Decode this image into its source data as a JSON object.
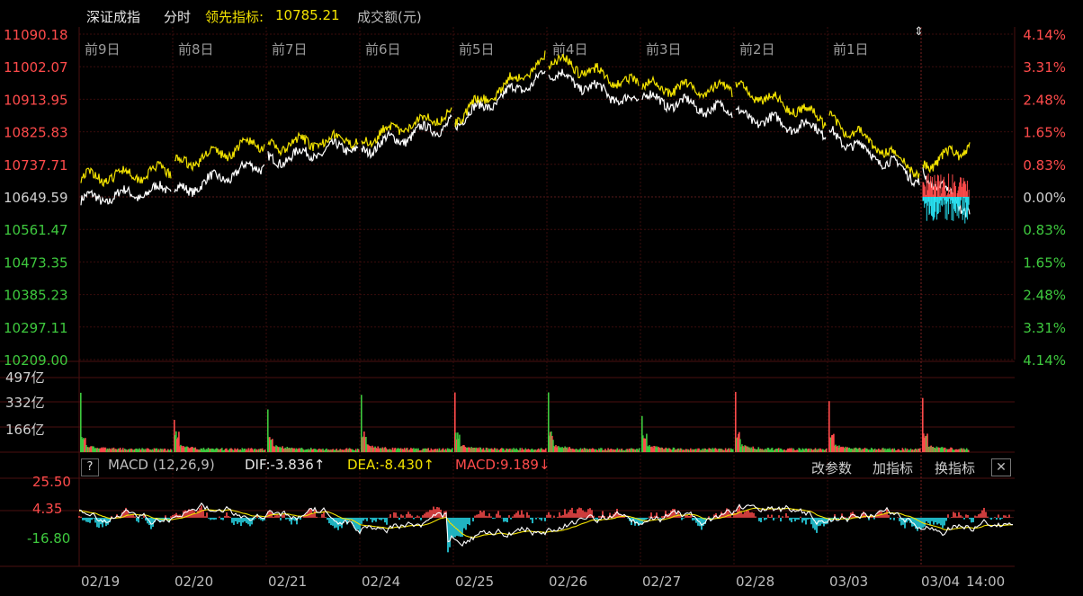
{
  "header": {
    "index_name": "深证成指",
    "mode": "分时",
    "leading_label": "领先指标:",
    "leading_value": "10785.21",
    "volume_label": "成交额(元)"
  },
  "macd_panel": {
    "help": "?",
    "title": "MACD (12,26,9)",
    "dif": "DIF:-3.836↑",
    "dea": "DEA:-8.430↑",
    "macd": "MACD:9.189↓",
    "buttons": [
      "改参数",
      "加指标",
      "换指标"
    ],
    "close": "✕"
  },
  "pin_icon": "⇕",
  "colors": {
    "background": "#000000",
    "grid": "#3a0c0c",
    "up": "#ff4b4b",
    "down": "#3ec93e",
    "price_line": "#ffffff",
    "leading_line": "#f2e200",
    "macd_neg": "#29e0f0",
    "dea_line": "#f2e200",
    "dif_line": "#ffffff"
  },
  "chart_data": {
    "type": "line",
    "price_axis": {
      "left_ticks": [
        "11090.18",
        "11002.07",
        "10913.95",
        "10825.83",
        "10737.71",
        "10649.59",
        "10561.47",
        "10473.35",
        "10385.23",
        "10297.11",
        "10209.00"
      ],
      "right_ticks": [
        "4.14%",
        "3.31%",
        "2.48%",
        "1.65%",
        "0.83%",
        "0.00%",
        "0.83%",
        "1.65%",
        "2.48%",
        "3.31%",
        "4.14%"
      ],
      "ylim": [
        10209.0,
        11090.18
      ],
      "base": 10649.59
    },
    "day_labels": [
      "前9日",
      "前8日",
      "前7日",
      "前6日",
      "前5日",
      "前4日",
      "前3日",
      "前2日",
      "前1日"
    ],
    "x_labels": [
      "02/19",
      "02/20",
      "02/21",
      "02/24",
      "02/25",
      "02/26",
      "02/27",
      "02/28",
      "03/03",
      "03/04",
      "14:00"
    ],
    "volume_axis": {
      "ticks": [
        "497亿",
        "332亿",
        "166亿"
      ],
      "max": 497
    },
    "macd_axis": {
      "ticks": [
        "25.50",
        "4.35",
        "-16.80"
      ],
      "ylim": [
        -30,
        32
      ]
    },
    "series": [
      {
        "name": "price",
        "day_close": [
          10670,
          10740,
          10790,
          10850,
          10980,
          10900,
          10880,
          10830,
          10700,
          10610
        ]
      },
      {
        "name": "leading",
        "day_close": [
          10720,
          10800,
          10810,
          10880,
          11020,
          10950,
          10940,
          10860,
          10720,
          10785.21
        ]
      }
    ]
  }
}
